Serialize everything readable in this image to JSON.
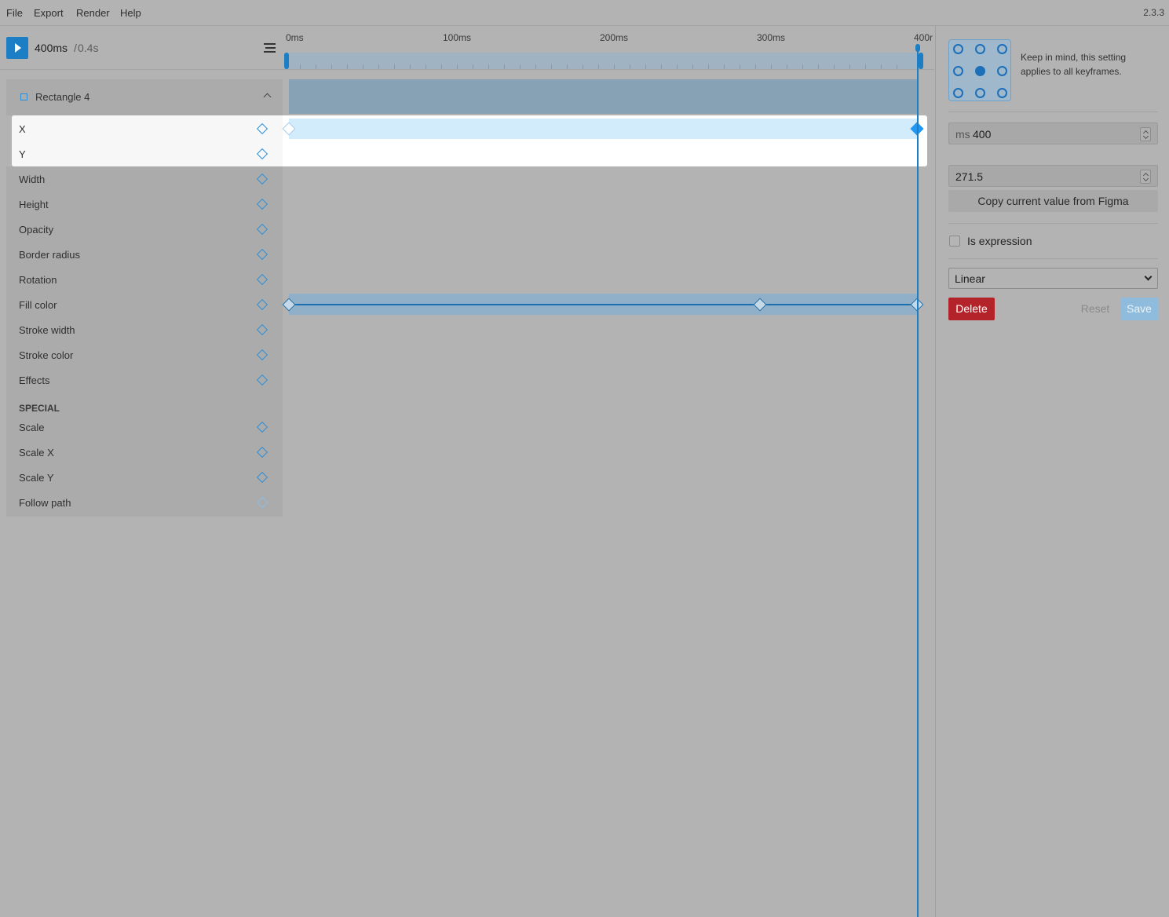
{
  "menu": {
    "file": "File",
    "export": "Export",
    "render": "Render",
    "help": "Help"
  },
  "version": "2.3.3",
  "toolbar": {
    "current_time": "400ms",
    "separator": "/",
    "total_time": "0.4s"
  },
  "ruler": {
    "labels": [
      "0ms",
      "100ms",
      "200ms",
      "300ms",
      "400r"
    ]
  },
  "layer": {
    "name": "Rectangle 4",
    "properties": [
      "X",
      "Y",
      "Width",
      "Height",
      "Opacity",
      "Border radius",
      "Rotation",
      "Fill color",
      "Stroke width",
      "Stroke color",
      "Effects"
    ],
    "special_heading": "SPECIAL",
    "special_properties": [
      "Scale",
      "Scale X",
      "Scale Y",
      "Follow path"
    ]
  },
  "inspector": {
    "anchor_note": "Keep in mind, this setting applies to all keyframes.",
    "anchor_selected": "center",
    "time_prefix": "ms",
    "time_value": "400",
    "value": "271.5",
    "copy_button": "Copy current value from Figma",
    "expression_label": "Is expression",
    "expression_checked": false,
    "easing": "Linear",
    "delete_button": "Delete",
    "reset_button": "Reset",
    "save_button": "Save"
  },
  "colors": {
    "accent": "#1c7fc6",
    "delete": "#b4232a",
    "save_disabled": "#8fbcdc"
  }
}
